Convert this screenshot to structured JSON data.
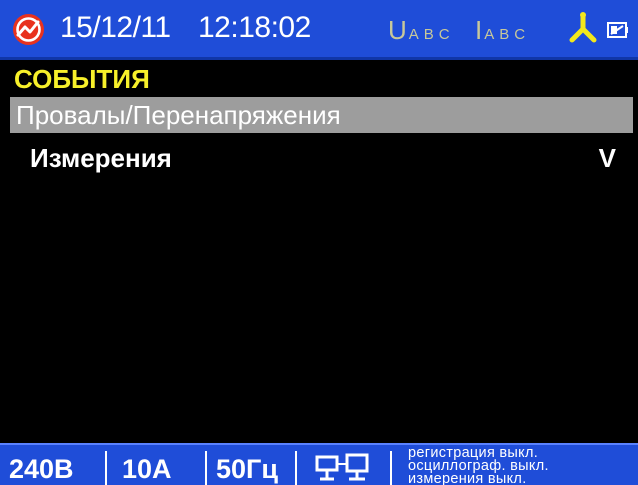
{
  "status_bar": {
    "date": "15/12/11",
    "time": "12:18:02",
    "voltage_indicator": {
      "letter": "U",
      "phases": "ABC"
    },
    "current_indicator": {
      "letter": "I",
      "phases": "ABC"
    },
    "icons": [
      "logo-icon",
      "phase-diagram-icon",
      "battery-icon"
    ]
  },
  "menu": {
    "title": "СОБЫТИЯ",
    "items": [
      {
        "label": "Провалы/Перенапряжения",
        "value": "",
        "selected": true
      },
      {
        "label": "Измерения",
        "value": "V",
        "selected": false
      }
    ]
  },
  "bottom_bar": {
    "voltage": "240В",
    "current": "10А",
    "frequency": "50Гц",
    "icons": [
      "network-icon"
    ],
    "status_lines": [
      "регистрация  выкл.",
      "осциллограф.  выкл.",
      "измерения  выкл."
    ]
  },
  "colors": {
    "bar_background": "#1f4dd8",
    "title_yellow": "#f7f02a",
    "selection_gray": "#9d9d9d",
    "indicator_dim": "#c8c89a",
    "logo_red": "#e8321e",
    "phase_yellow": "#f2e81c"
  }
}
